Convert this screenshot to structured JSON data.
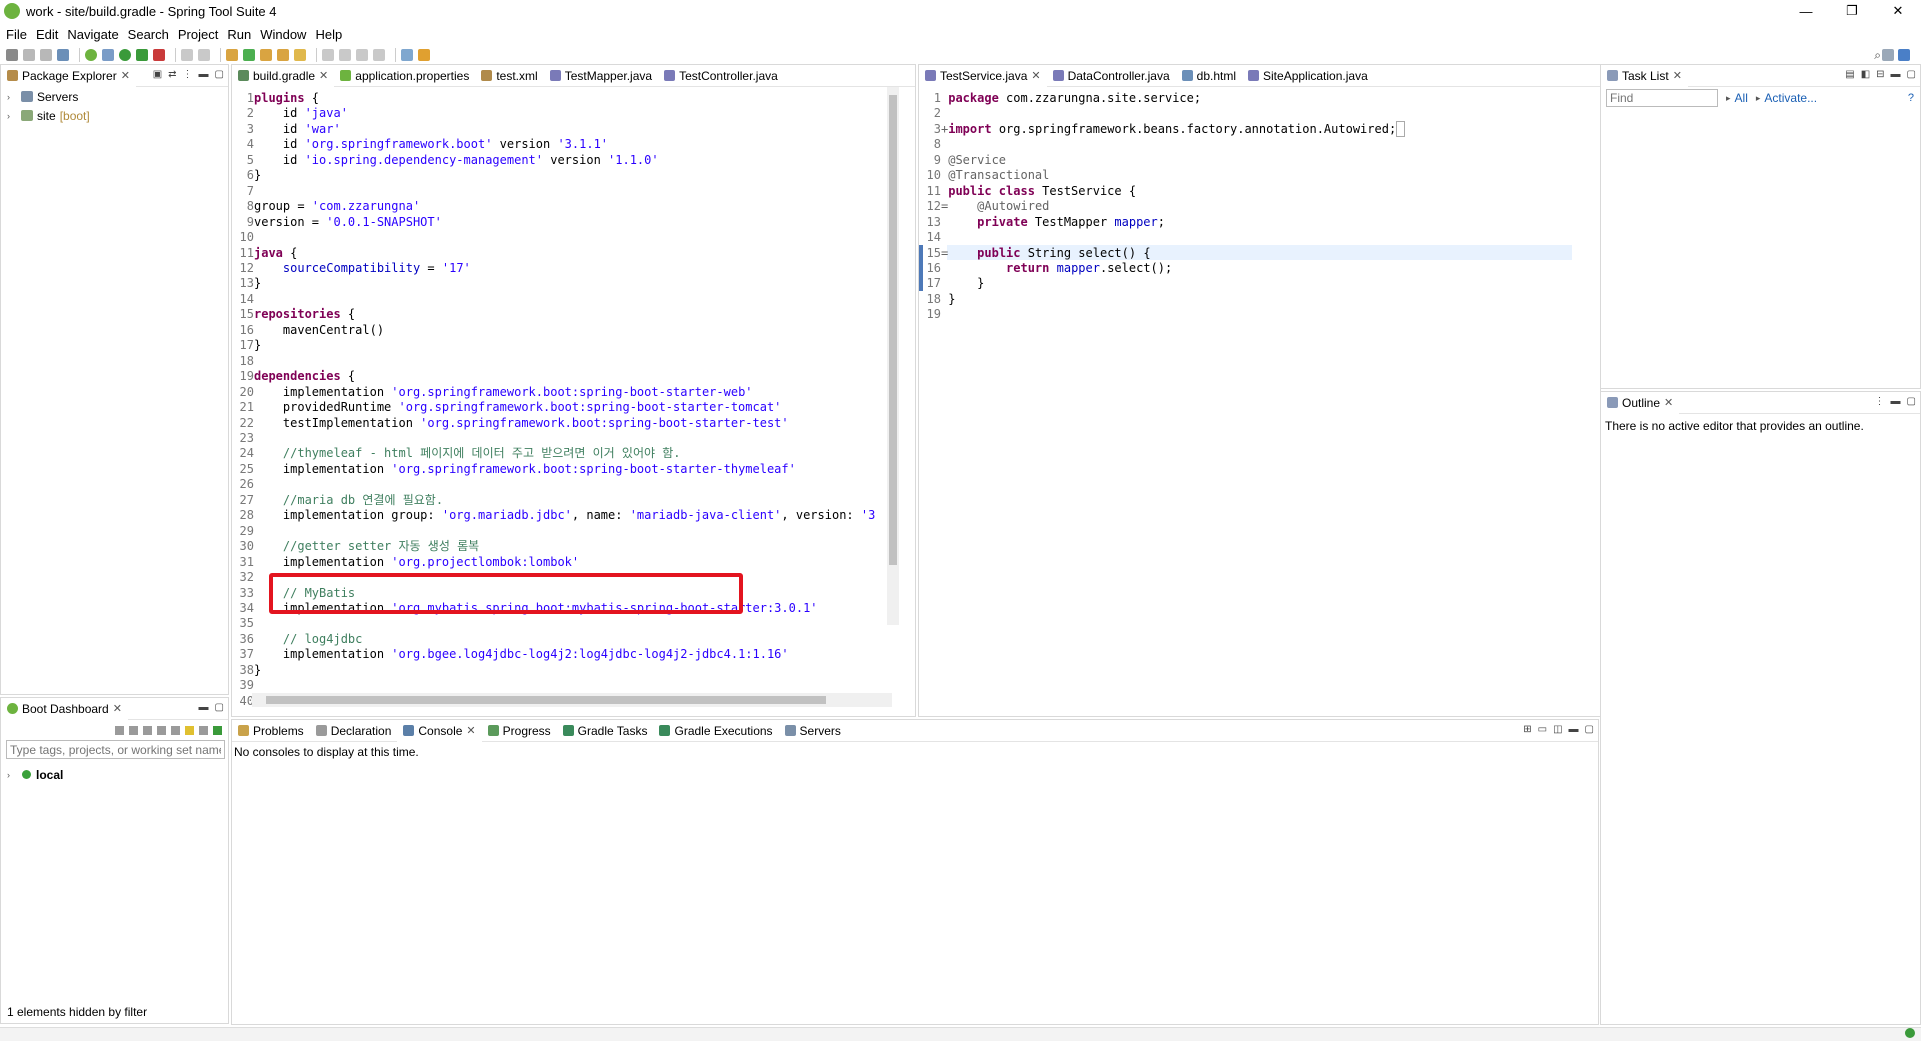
{
  "window": {
    "title": "work - site/build.gradle - Spring Tool Suite 4",
    "min": "—",
    "max": "❐",
    "close": "✕"
  },
  "menu": [
    "File",
    "Edit",
    "Navigate",
    "Search",
    "Project",
    "Run",
    "Window",
    "Help"
  ],
  "package_explorer": {
    "tab": "Package Explorer",
    "items": [
      {
        "label": "Servers",
        "suffix": ""
      },
      {
        "label": "site",
        "suffix": "[boot]"
      }
    ]
  },
  "boot_dashboard": {
    "tab": "Boot Dashboard",
    "filter_placeholder": "Type tags, projects, or working set names",
    "local": "local",
    "status": "1 elements hidden by filter"
  },
  "left_editor": {
    "tabs": [
      {
        "label": "build.gradle",
        "active": true,
        "closable": true
      },
      {
        "label": "application.properties"
      },
      {
        "label": "test.xml"
      },
      {
        "label": "TestMapper.java"
      },
      {
        "label": "TestController.java"
      }
    ]
  },
  "right_editor": {
    "tabs": [
      {
        "label": "TestService.java",
        "active": true,
        "closable": true
      },
      {
        "label": "DataController.java"
      },
      {
        "label": "db.html"
      },
      {
        "label": "SiteApplication.java"
      }
    ]
  },
  "task_list": {
    "tab": "Task List",
    "find_placeholder": "Find",
    "all": "All",
    "activate": "Activate..."
  },
  "outline": {
    "tab": "Outline",
    "message": "There is no active editor that provides an outline."
  },
  "bottom": {
    "tabs": [
      "Problems",
      "Declaration",
      "Console",
      "Progress",
      "Gradle Tasks",
      "Gradle Executions",
      "Servers"
    ],
    "active": "Console",
    "message": "No consoles to display at this time."
  },
  "colors": {
    "highlight": "#e3141f",
    "keyword": "#7f0055",
    "string": "#2a00ff",
    "comment": "#3f7f5f"
  }
}
